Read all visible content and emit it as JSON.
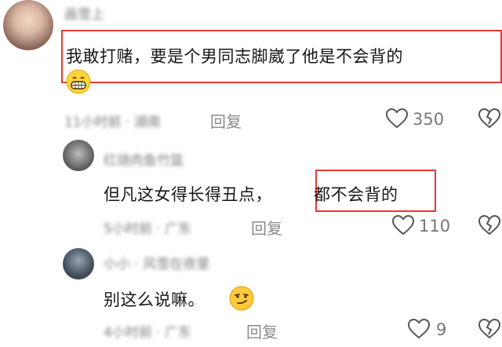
{
  "comments": [
    {
      "username_blurred": "画雪上",
      "text": "我敢打赌，要是个男同志脚崴了他是不会背的",
      "emoji": "grinning-face",
      "time_blurred": "11小时前 · 湖南",
      "reply_label": "回复",
      "like_count": "350",
      "highlight_color": "#e53935"
    },
    {
      "username_blurred": "红烧肉鱼竹篮",
      "text_plain": "但凡这女得长得丑点，",
      "text_highlight": "都不会背的",
      "time_blurred": "5小时前 · 广东",
      "reply_label": "回复",
      "like_count": "110",
      "highlight_color": "#e53935"
    },
    {
      "username_blurred": "小小 · 风雪在夜里",
      "text": "别这么说嘛。",
      "emoji": "smirking-face",
      "time_blurred": "4小时前 · 广东",
      "reply_label": "回复",
      "like_count": "9"
    }
  ]
}
